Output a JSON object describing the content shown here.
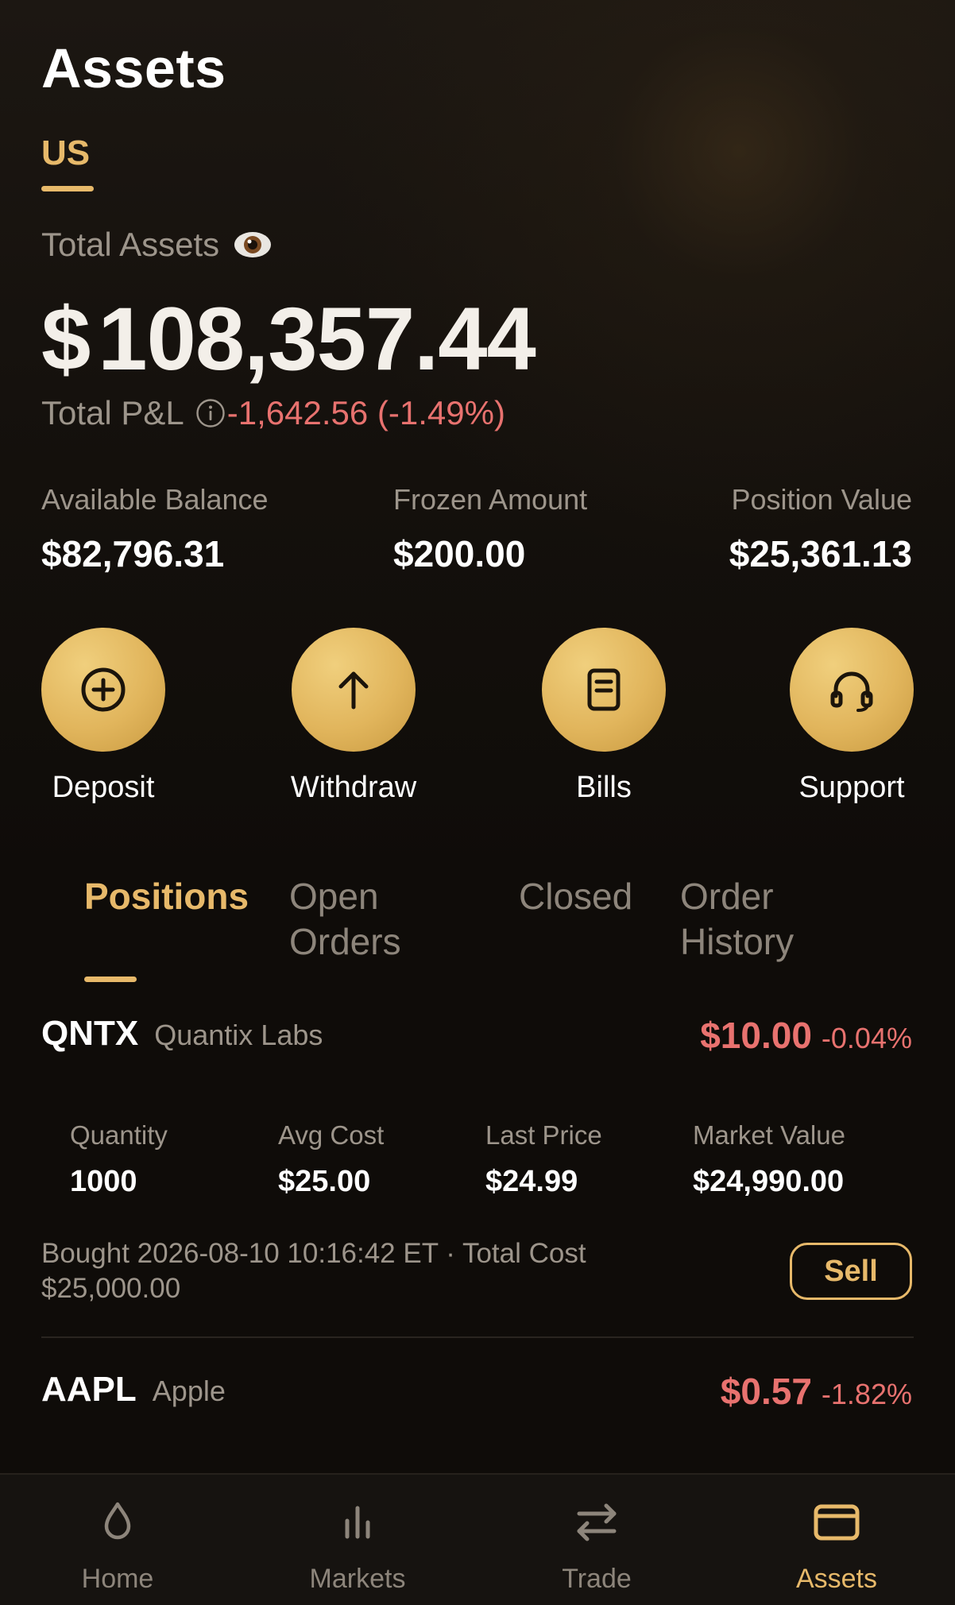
{
  "header": {
    "title": "Assets"
  },
  "region_tab": {
    "label": "US"
  },
  "summary": {
    "total_label": "Total Assets",
    "currency": "$",
    "total_amount": "108,357.44",
    "pnl_label": "Total P&L",
    "pnl_value": "-1,642.56 (-1.49%)"
  },
  "stats": [
    {
      "label": "Available Balance",
      "currency": "$",
      "value": "82,796.31"
    },
    {
      "label": "Frozen Amount",
      "currency": "$",
      "value": "200.00"
    },
    {
      "label": "Position Value",
      "currency": "$",
      "value": "25,361.13"
    }
  ],
  "actions": [
    {
      "label": "Deposit",
      "icon": "plus-circle-icon"
    },
    {
      "label": "Withdraw",
      "icon": "arrow-up-icon"
    },
    {
      "label": "Bills",
      "icon": "document-icon"
    },
    {
      "label": "Support",
      "icon": "headset-icon"
    }
  ],
  "position_tabs": [
    {
      "label": "Positions",
      "active": true
    },
    {
      "label": "Open\nOrders",
      "active": false
    },
    {
      "label": "Closed",
      "active": false
    },
    {
      "label": "Order\nHistory",
      "active": false
    }
  ],
  "positions": [
    {
      "symbol": "QNTX",
      "company": "Quantix Labs",
      "price": "$10.00",
      "change": "-0.04%",
      "columns": [
        {
          "label": "Quantity",
          "value": "1000"
        },
        {
          "label": "Avg Cost",
          "value": "$25.00"
        },
        {
          "label": "Last Price",
          "value": "$24.99"
        },
        {
          "label": "Market Value",
          "value": "$24,990.00"
        }
      ],
      "bought_line1": "Bought 2026-08-10 10:16:42 ET · Total Cost",
      "bought_line2": "$25,000.00",
      "sell_label": "Sell"
    },
    {
      "symbol": "AAPL",
      "company": "Apple",
      "price": "$0.57",
      "change": "-1.82%"
    }
  ],
  "bottom_nav": [
    {
      "label": "Home",
      "icon": "drop-icon",
      "active": false
    },
    {
      "label": "Markets",
      "icon": "bar-chart-icon",
      "active": false
    },
    {
      "label": "Trade",
      "icon": "swap-arrows-icon",
      "active": false
    },
    {
      "label": "Assets",
      "icon": "wallet-icon",
      "active": true
    }
  ],
  "colors": {
    "accent": "#e7b96a",
    "negative": "#e8726f",
    "muted_text": "#9d958b",
    "background": "#0f0c09"
  }
}
